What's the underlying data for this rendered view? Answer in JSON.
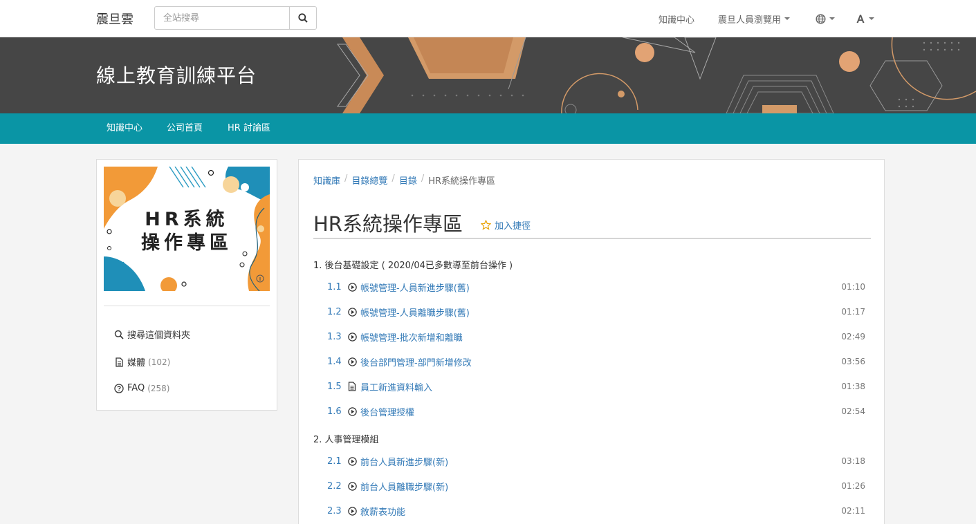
{
  "topbar": {
    "brand": "震旦雲",
    "search_placeholder": "全站搜尋",
    "nav_knowledge": "知識中心",
    "user_menu": "震旦人員瀏覽用"
  },
  "banner": {
    "title": "線上教育訓練平台"
  },
  "mainnav": [
    "知識中心",
    "公司首頁",
    "HR 討論區"
  ],
  "sidebar": {
    "cover_lines": [
      "HR系統",
      "操作專區"
    ],
    "search_folder": "搜尋這個資料夾",
    "media_label": "媒體",
    "media_count": "(102)",
    "faq_label": "FAQ",
    "faq_count": "(258)"
  },
  "main": {
    "breadcrumb": [
      "知識庫",
      "目錄總覽",
      "目錄",
      "HR系統操作專區"
    ],
    "title": "HR系統操作專區",
    "shortcut": "加入捷徑",
    "sections": [
      {
        "label": "1.  後台基礎設定 ( 2020/04已多數導至前台操作 )",
        "items": [
          {
            "num": "1.1",
            "icon": "play-icon",
            "title": "帳號管理-人員新進步驟(舊)",
            "duration": "01:10"
          },
          {
            "num": "1.2",
            "icon": "play-icon",
            "title": "帳號管理-人員離職步驟(舊)",
            "duration": "01:17"
          },
          {
            "num": "1.3",
            "icon": "play-icon",
            "title": "帳號管理-批次新增和離職",
            "duration": "02:49"
          },
          {
            "num": "1.4",
            "icon": "play-icon",
            "title": "後台部門管理-部門新增修改",
            "duration": "03:56"
          },
          {
            "num": "1.5",
            "icon": "document-icon",
            "title": "員工新進資料輸入",
            "duration": "01:38"
          },
          {
            "num": "1.6",
            "icon": "play-icon",
            "title": "後台管理授權",
            "duration": "02:54"
          }
        ]
      },
      {
        "label": "2.  人事管理模組",
        "items": [
          {
            "num": "2.1",
            "icon": "play-icon",
            "title": "前台人員新進步驟(新)",
            "duration": "03:18"
          },
          {
            "num": "2.2",
            "icon": "play-icon",
            "title": "前台人員離職步驟(新)",
            "duration": "01:26"
          },
          {
            "num": "2.3",
            "icon": "play-icon",
            "title": "敘薪表功能",
            "duration": "02:11"
          }
        ]
      }
    ]
  },
  "colors": {
    "teal_nav": "#0a95a5",
    "banner_bg": "#464646",
    "accent_orange": "#f29a38",
    "cover_blue": "#1f8fb8",
    "link": "#337ab7"
  }
}
